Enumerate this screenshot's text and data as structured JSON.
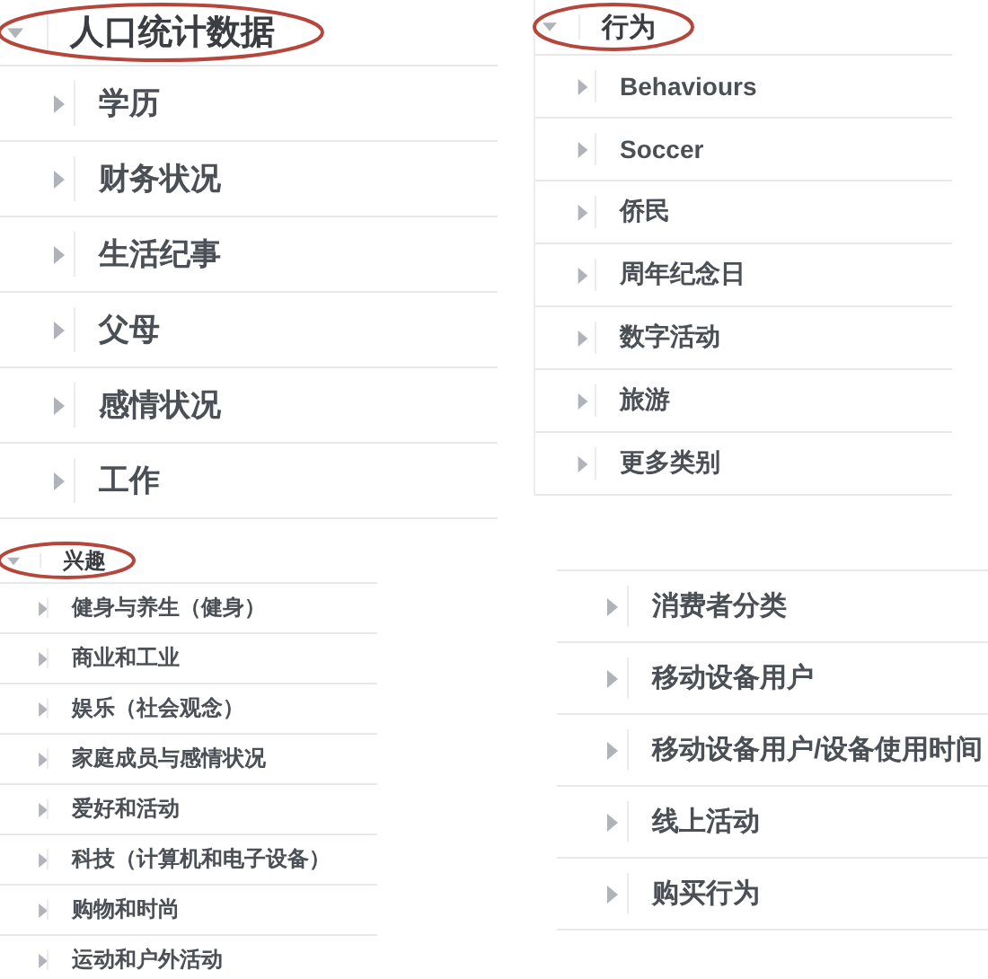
{
  "panels": [
    {
      "header": {
        "label": "人口统计数据",
        "expanded": true,
        "circled": true
      },
      "items": [
        {
          "label": "学历",
          "expanded": false
        },
        {
          "label": "财务状况",
          "expanded": false
        },
        {
          "label": "生活纪事",
          "expanded": false
        },
        {
          "label": "父母",
          "expanded": false
        },
        {
          "label": "感情状况",
          "expanded": false
        },
        {
          "label": "工作",
          "expanded": false
        }
      ]
    },
    {
      "header": {
        "label": "行为",
        "expanded": true,
        "circled": true
      },
      "items": [
        {
          "label": "Behaviours",
          "expanded": false
        },
        {
          "label": "Soccer",
          "expanded": false
        },
        {
          "label": "侨民",
          "expanded": false
        },
        {
          "label": "周年纪念日",
          "expanded": false
        },
        {
          "label": "数字活动",
          "expanded": false
        },
        {
          "label": "旅游",
          "expanded": false
        },
        {
          "label": "更多类别",
          "expanded": false
        }
      ]
    },
    {
      "header": {
        "label": "兴趣",
        "expanded": true,
        "circled": true
      },
      "items": [
        {
          "label": "健身与养生（健身）",
          "expanded": false
        },
        {
          "label": "商业和工业",
          "expanded": false
        },
        {
          "label": "娱乐（社会观念）",
          "expanded": false
        },
        {
          "label": "家庭成员与感情状况",
          "expanded": false
        },
        {
          "label": "爱好和活动",
          "expanded": false
        },
        {
          "label": "科技（计算机和电子设备）",
          "expanded": false
        },
        {
          "label": "购物和时尚",
          "expanded": false
        },
        {
          "label": "运动和户外活动",
          "expanded": false
        }
      ]
    },
    {
      "items": [
        {
          "label": "消费者分类",
          "expanded": false
        },
        {
          "label": "移动设备用户",
          "expanded": false
        },
        {
          "label": "移动设备用户/设备使用时间",
          "expanded": false
        },
        {
          "label": "线上活动",
          "expanded": false
        },
        {
          "label": "购买行为",
          "expanded": false
        }
      ]
    }
  ]
}
